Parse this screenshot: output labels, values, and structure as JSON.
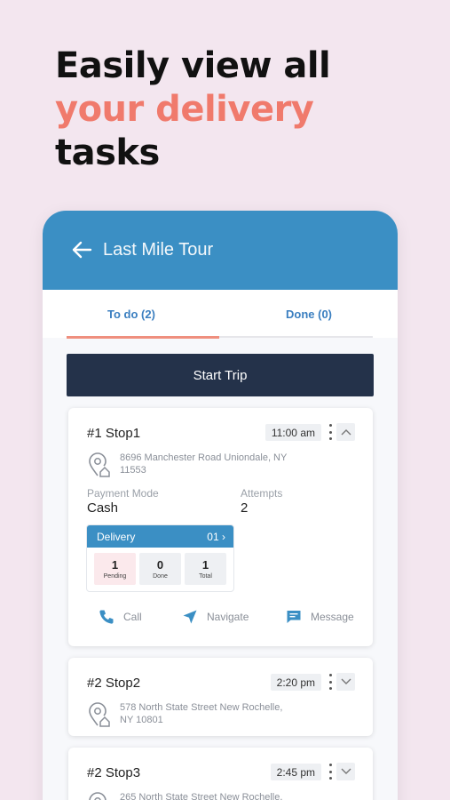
{
  "headline": {
    "line1": "Easily view all",
    "line2": "your delivery",
    "line3": "tasks"
  },
  "appbar": {
    "back_icon": "arrow-left-icon",
    "title": "Last Mile Tour"
  },
  "tabs": [
    {
      "label": "To do (2)",
      "active": true
    },
    {
      "label": "Done (0)",
      "active": false
    }
  ],
  "start_trip_label": "Start Trip",
  "stops": [
    {
      "title": "#1 Stop1",
      "time": "11:00 am",
      "address_line1": "8696 Manchester Road Uniondale, NY",
      "address_line2": "11553",
      "expanded": true,
      "payment_mode_label": "Payment Mode",
      "payment_mode": "Cash",
      "attempts_label": "Attempts",
      "attempts": "2",
      "delivery": {
        "label": "Delivery",
        "count": "01",
        "chevron": "›",
        "stats": [
          {
            "value": "1",
            "label": "Pending"
          },
          {
            "value": "0",
            "label": "Done"
          },
          {
            "value": "1",
            "label": "Total"
          }
        ]
      },
      "actions": {
        "call": "Call",
        "navigate": "Navigate",
        "message": "Message"
      }
    },
    {
      "title": "#2 Stop2",
      "time": "2:20 pm",
      "address_line1": "578 North State Street New Rochelle,",
      "address_line2": "NY 10801",
      "expanded": false
    },
    {
      "title": "#2 Stop3",
      "time": "2:45 pm",
      "address_line1": "265 North State Street New Rochelle,",
      "address_line2": "",
      "expanded": false
    }
  ],
  "colors": {
    "background": "#f3e6ef",
    "accent": "#f07a6c",
    "appbar": "#3b8fc4",
    "button_dark": "#24324a",
    "tab_text": "#3b7fc0"
  }
}
